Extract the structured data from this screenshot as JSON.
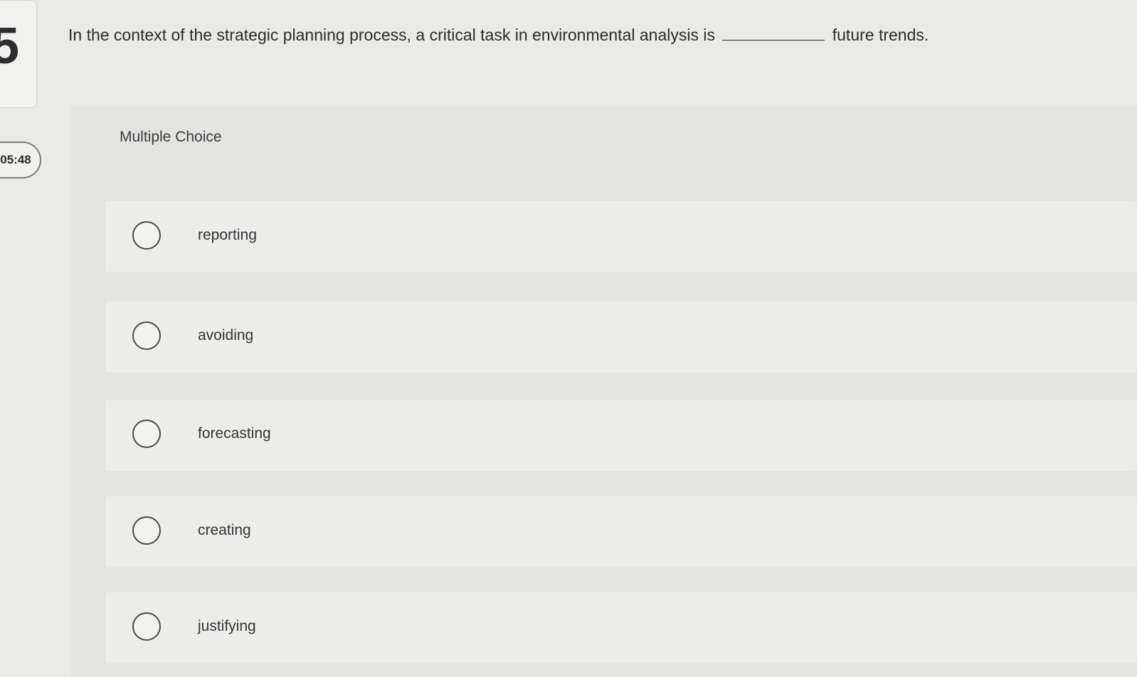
{
  "sidebar": {
    "question_number": "5",
    "timer": "05:48"
  },
  "question": {
    "text_before": "In the context of the strategic planning process, a critical task in environmental analysis is",
    "text_after": "future trends."
  },
  "choices": {
    "title": "Multiple Choice",
    "options": [
      {
        "label": "reporting"
      },
      {
        "label": "avoiding"
      },
      {
        "label": "forecasting"
      },
      {
        "label": "creating"
      },
      {
        "label": "justifying"
      }
    ]
  }
}
